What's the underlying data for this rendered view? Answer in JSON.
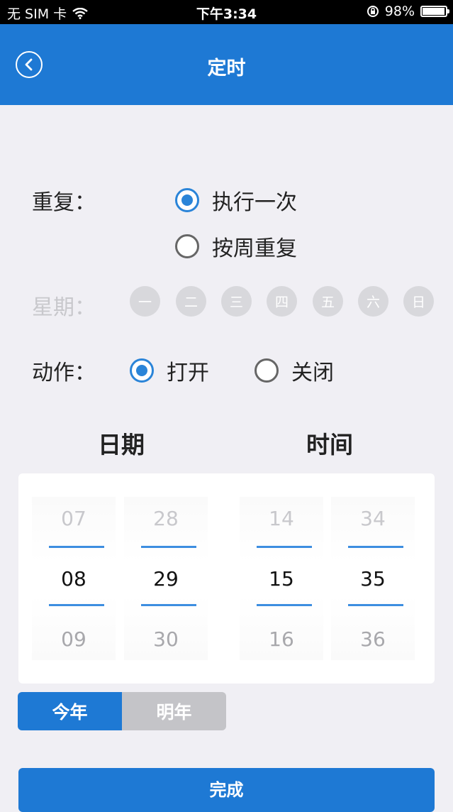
{
  "status_bar": {
    "carrier": "无 SIM 卡",
    "time": "下午3:34",
    "battery": "98%",
    "battery_level": 0.98
  },
  "nav": {
    "title": "定时"
  },
  "repeat": {
    "label": "重复：",
    "options": [
      {
        "label": "执行一次",
        "checked": true
      },
      {
        "label": "按周重复",
        "checked": false
      }
    ]
  },
  "weekdays": {
    "label": "星期：",
    "days": [
      "一",
      "二",
      "三",
      "四",
      "五",
      "六",
      "日"
    ]
  },
  "action": {
    "label": "动作：",
    "options": [
      {
        "label": "打开",
        "checked": true
      },
      {
        "label": "关闭",
        "checked": false
      }
    ]
  },
  "picker": {
    "date_title": "日期",
    "time_title": "时间",
    "columns": [
      {
        "prev": "07",
        "selected": "08",
        "next": "09"
      },
      {
        "prev": "28",
        "selected": "29",
        "next": "30"
      },
      {
        "prev": "14",
        "selected": "15",
        "next": "16"
      },
      {
        "prev": "34",
        "selected": "35",
        "next": "36"
      }
    ]
  },
  "year": {
    "this_year": "今年",
    "next_year": "明年"
  },
  "done_label": "完成",
  "colors": {
    "primary": "#1e79d4",
    "radio_checked": "#2a84d8"
  }
}
